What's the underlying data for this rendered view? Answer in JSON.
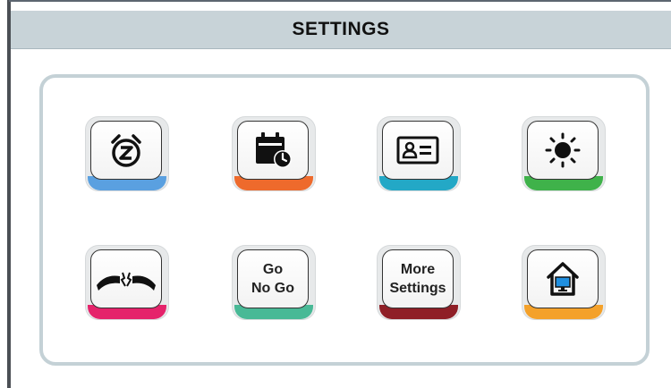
{
  "header": {
    "title": "SETTINGS"
  },
  "buttons": [
    {
      "id": "sleep",
      "icon": "alarm-clock-z-icon",
      "bar_color": "#5aa0e0"
    },
    {
      "id": "schedule",
      "icon": "calendar-clock-icon",
      "bar_color": "#ee6a2c"
    },
    {
      "id": "user-id",
      "icon": "id-card-icon",
      "bar_color": "#23a8c6"
    },
    {
      "id": "brightness",
      "icon": "sun-icon",
      "bar_color": "#3fb24a"
    },
    {
      "id": "disconnect",
      "icon": "broken-cable-icon",
      "bar_color": "#e5236b"
    },
    {
      "id": "go-no-go",
      "label_line1": "Go",
      "label_line2": "No Go",
      "bar_color": "#48b996"
    },
    {
      "id": "more-settings",
      "label_line1": "More",
      "label_line2": "Settings",
      "bar_color": "#8f1f27"
    },
    {
      "id": "home",
      "icon": "home-monitor-icon",
      "bar_color": "#f4a12a"
    }
  ]
}
